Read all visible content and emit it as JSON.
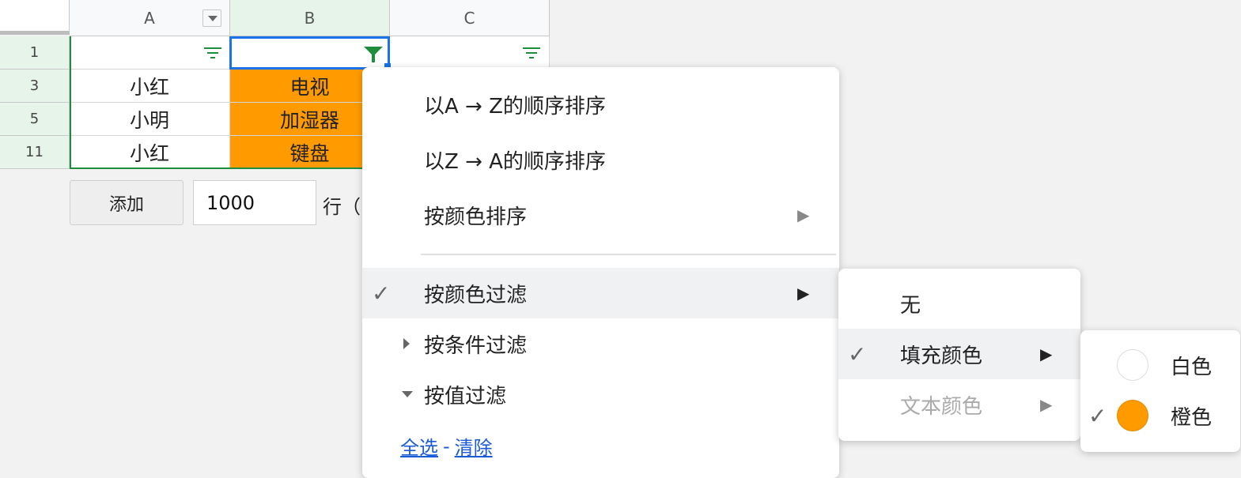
{
  "columns": [
    "A",
    "B",
    "C"
  ],
  "rows": [
    {
      "num": "1",
      "a": "",
      "b": "",
      "c": ""
    },
    {
      "num": "3",
      "a": "小红",
      "b": "电视"
    },
    {
      "num": "5",
      "a": "小明",
      "b": "加湿器"
    },
    {
      "num": "11",
      "a": "小红",
      "b": "键盘"
    }
  ],
  "add_rows": {
    "button_label": "添加",
    "count_value": "1000",
    "unit_label": "行（"
  },
  "filter_menu": {
    "sort_az": "以A → Z的顺序排序",
    "sort_za": "以Z → A的顺序排序",
    "sort_by_color": "按颜色排序",
    "filter_by_color": "按颜色过滤",
    "filter_by_condition": "按条件过滤",
    "filter_by_value": "按值过滤",
    "select_all": "全选",
    "link_separator": "-",
    "clear": "清除",
    "arrow": "▶",
    "check": "✓"
  },
  "color_type_menu": {
    "none": "无",
    "fill_color": "填充颜色",
    "text_color": "文本颜色"
  },
  "fill_color_menu": {
    "white": "白色",
    "orange": "橙色",
    "white_hex": "#ffffff",
    "orange_hex": "#ff9b00"
  },
  "colors": {
    "accent_blue": "#1a73e8",
    "filter_green": "#1e8e3e",
    "cell_orange": "#ff9b00"
  }
}
